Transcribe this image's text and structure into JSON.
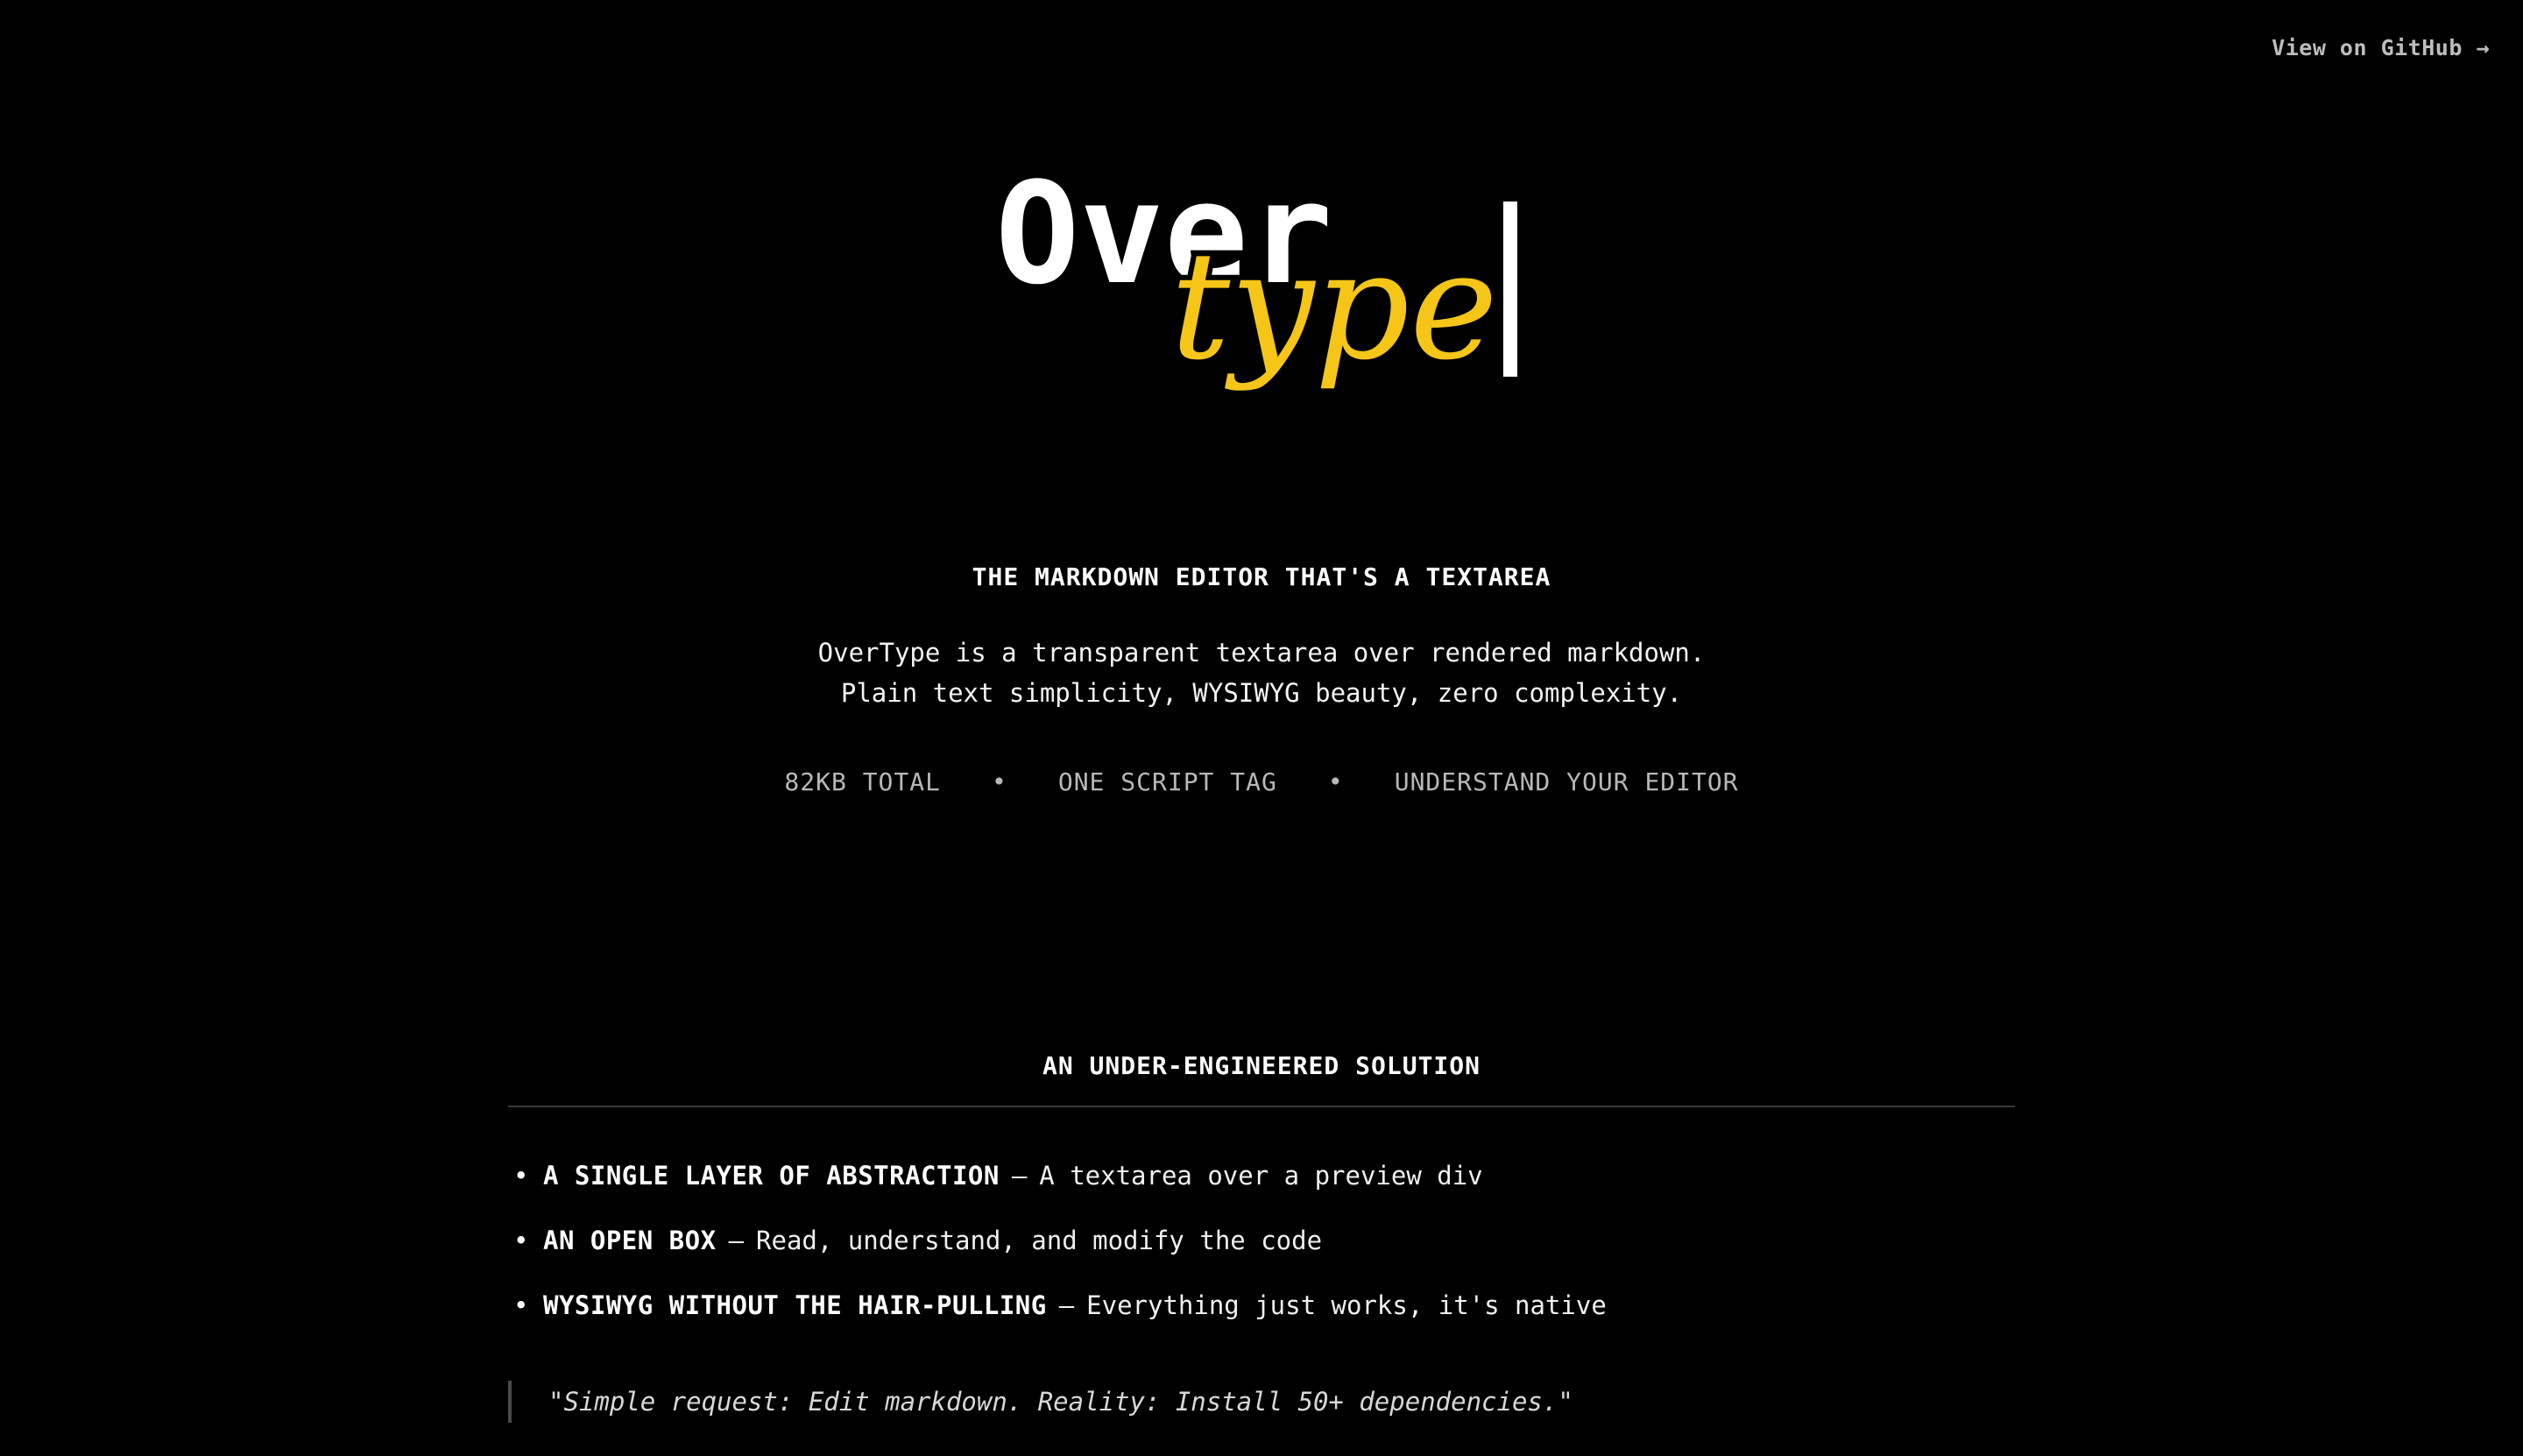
{
  "header": {
    "github_link": "View on GitHub →"
  },
  "logo": {
    "word_primary": "Over",
    "word_secondary": "type",
    "primary_color": "#ffffff",
    "accent_color": "#f5c518"
  },
  "hero": {
    "tagline": "THE MARKDOWN EDITOR THAT'S A TEXTAREA",
    "description_line1": "OverType is a transparent textarea over rendered markdown.",
    "description_line2": "Plain text simplicity, WYSIWYG beauty, zero complexity.",
    "features": [
      "82KB TOTAL",
      "ONE SCRIPT TAG",
      "UNDERSTAND YOUR EDITOR"
    ],
    "separator": "•"
  },
  "section": {
    "title": "AN UNDER-ENGINEERED SOLUTION",
    "items": [
      {
        "bullet": "•",
        "label": "A SINGLE LAYER OF ABSTRACTION",
        "dash": "–",
        "text": "A textarea over a preview div"
      },
      {
        "bullet": "•",
        "label": "AN OPEN BOX",
        "dash": "–",
        "text": "Read, understand, and modify the code"
      },
      {
        "bullet": "•",
        "label": "WYSIWYG WITHOUT THE HAIR-PULLING",
        "dash": "–",
        "text": "Everything just works, it's native"
      }
    ],
    "quote": "\"Simple request: Edit markdown. Reality: Install 50+ dependencies.\""
  }
}
